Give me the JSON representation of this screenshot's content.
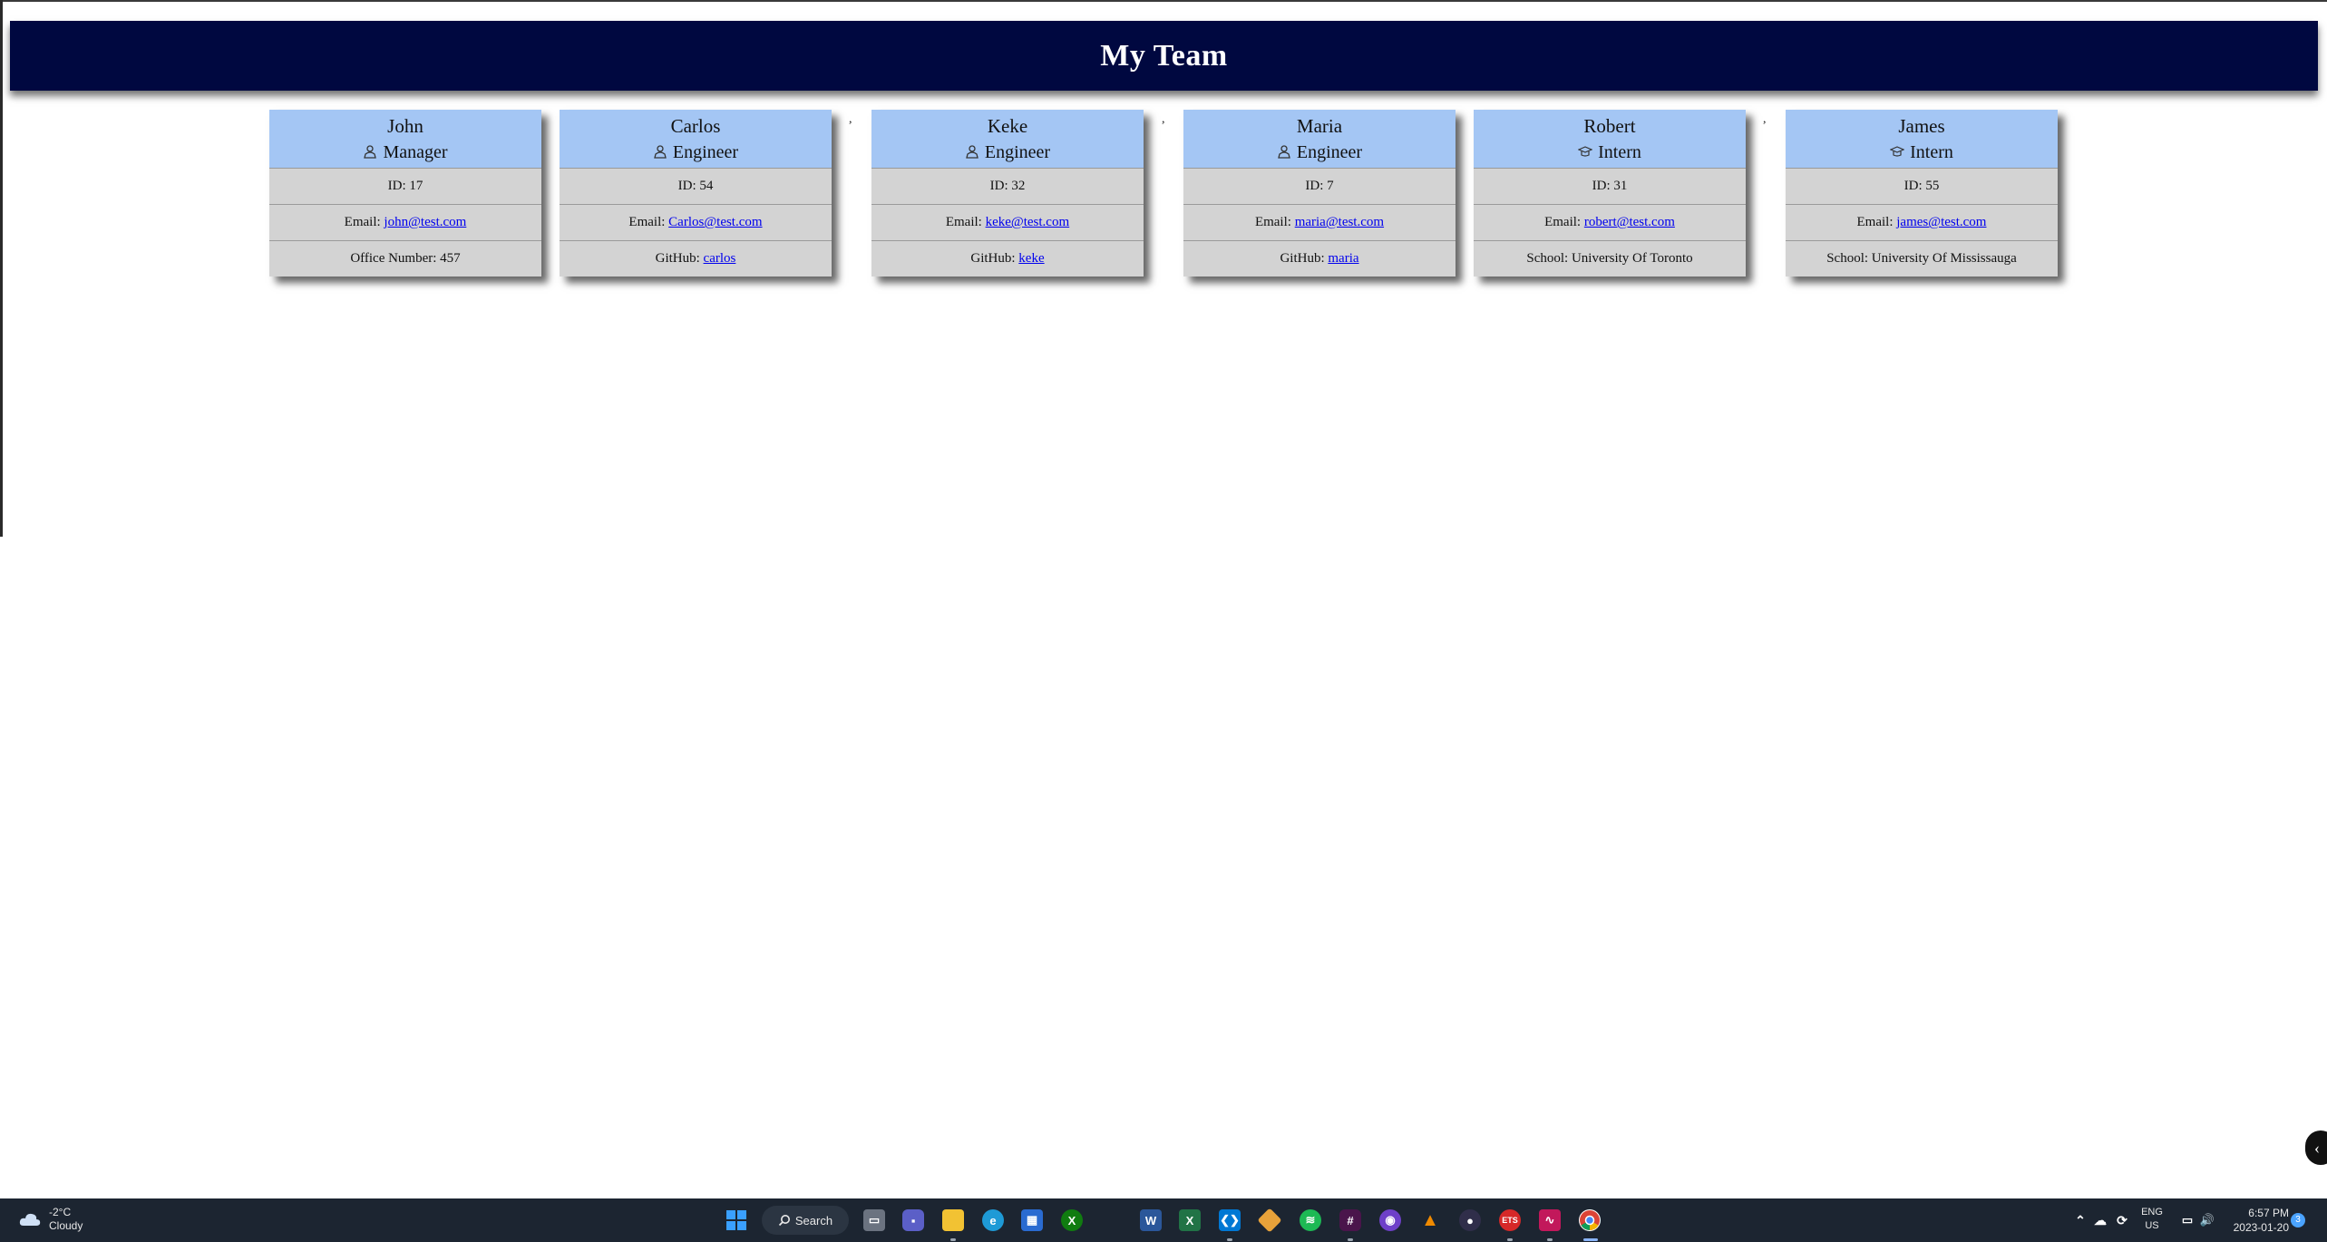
{
  "header": {
    "title": "My Team"
  },
  "team": [
    {
      "name": "John",
      "role": "Manager",
      "role_icon": "person-icon",
      "id_label": "ID: 17",
      "email_prefix": "Email: ",
      "email": "john@test.com",
      "extra_prefix": "Office Number: 457",
      "extra_link": ""
    },
    {
      "name": "Carlos",
      "role": "Engineer",
      "role_icon": "person-icon",
      "id_label": "ID: 54",
      "email_prefix": "Email: ",
      "email": "Carlos@test.com",
      "extra_prefix": "GitHub: ",
      "extra_link": "carlos"
    },
    {
      "name": "Keke",
      "role": "Engineer",
      "role_icon": "person-icon",
      "id_label": "ID: 32",
      "email_prefix": "Email: ",
      "email": "keke@test.com",
      "extra_prefix": "GitHub: ",
      "extra_link": "keke"
    },
    {
      "name": "Maria",
      "role": "Engineer",
      "role_icon": "person-icon",
      "id_label": "ID: 7",
      "email_prefix": "Email: ",
      "email": "maria@test.com",
      "extra_prefix": "GitHub: ",
      "extra_link": "maria"
    },
    {
      "name": "Robert",
      "role": "Intern",
      "role_icon": "graduation-cap-icon",
      "id_label": "ID: 31",
      "email_prefix": "Email: ",
      "email": "robert@test.com",
      "extra_prefix": "School: University Of Toronto",
      "extra_link": ""
    },
    {
      "name": "James",
      "role": "Intern",
      "role_icon": "graduation-cap-icon",
      "id_label": "ID: 55",
      "email_prefix": "Email: ",
      "email": "james@test.com",
      "extra_prefix": "School: University Of Mississauga",
      "extra_link": ""
    }
  ],
  "separators": [
    ","
  ],
  "taskbar": {
    "weather": {
      "temp": "-2°C",
      "condition": "Cloudy",
      "icon": "cloud-icon"
    },
    "search_label": "Search",
    "language": {
      "line1": "ENG",
      "line2": "US"
    },
    "clock": {
      "time": "6:57 PM",
      "date": "2023-01-20"
    },
    "notification_count": "3",
    "pinned_apps": [
      "start",
      "search",
      "task-view",
      "teams-chat",
      "file-explorer",
      "edge",
      "microsoft-store",
      "xbox",
      "word",
      "excel",
      "vs-code",
      "git-tool",
      "spotify",
      "slack",
      "github-desktop",
      "vlc",
      "obs",
      "app-red",
      "app-pink",
      "chrome"
    ]
  }
}
